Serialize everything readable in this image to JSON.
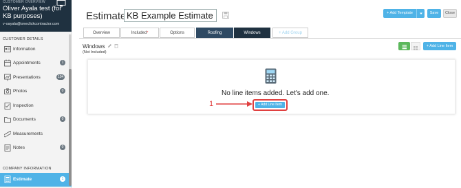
{
  "sidebar": {
    "overline": "CUSTOMER OVERVIEW",
    "customer_name": "Oliver Ayala test (for KB purposes)",
    "customer_email": "v-oayala@oneclickcontractor.com",
    "section_customer_details": "CUSTOMER DETAILS",
    "section_company_info": "COMPANY INFORMATION",
    "items": [
      {
        "label": "Information",
        "badge": "",
        "icon": "info-card-icon"
      },
      {
        "label": "Appointments",
        "badge": "1",
        "icon": "calendar-icon"
      },
      {
        "label": "Presentations",
        "badge": "104",
        "icon": "presentation-chart-icon"
      },
      {
        "label": "Photos",
        "badge": "0",
        "icon": "camera-icon"
      },
      {
        "label": "Inspection",
        "badge": "",
        "icon": "inspection-icon"
      },
      {
        "label": "Documents",
        "badge": "0",
        "icon": "folder-icon"
      },
      {
        "label": "Measurements",
        "badge": "",
        "icon": "ruler-icon"
      },
      {
        "label": "Notes",
        "badge": "0",
        "icon": "notes-icon"
      }
    ],
    "active_item": {
      "label": "Estimate",
      "badge": "1",
      "icon": "calculator-icon"
    }
  },
  "header": {
    "estimate_label": "Estimate:",
    "estimate_name": "KB Example Estimate",
    "add_template_label": "+ Add Template",
    "save_label": "Save",
    "close_label": "Close"
  },
  "tabs": [
    {
      "label": "Overview"
    },
    {
      "label": "Included",
      "required_mark": "*"
    },
    {
      "label": "Options"
    },
    {
      "label": "Roofing"
    },
    {
      "label": "Windows"
    },
    {
      "label": "+ Add Group"
    }
  ],
  "section": {
    "title": "Windows",
    "subtitle": "(Not Included)",
    "add_line_item_label": "+ Add Line Item"
  },
  "empty_state": {
    "message": "No line items added. Let's add one.",
    "add_line_item_label": "+ Add Line Item",
    "step_number": "1"
  },
  "colors": {
    "accent": "#4fb3e7",
    "sidebar_header": "#1f3140",
    "tab_active": "#1f3140",
    "tab_roofing": "#2f4a63",
    "highlight": "#e04040",
    "view_toggle": "#5cb85c"
  }
}
